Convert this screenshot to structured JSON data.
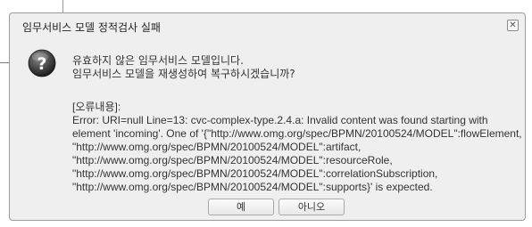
{
  "dialog": {
    "title": "임무서비스 모델 정적검사 실패",
    "close_symbol": "✕",
    "icon": "question-icon",
    "message_lines": [
      "유효하지 않은 임무서비스 모델입니다.",
      "임무서비스 모델을 재생성하여 복구하시겠습니까?"
    ],
    "detail_header": "[오류내용]:",
    "detail_lines": [
      "Error: URI=null Line=13: cvc-complex-type.2.4.a: Invalid content was found starting with",
      "element 'incoming'. One of '{\"http://www.omg.org/spec/BPMN/20100524/MODEL\":flowElement,",
      "\"http://www.omg.org/spec/BPMN/20100524/MODEL\":artifact,",
      "\"http://www.omg.org/spec/BPMN/20100524/MODEL\":resourceRole,",
      "\"http://www.omg.org/spec/BPMN/20100524/MODEL\":correlationSubscription,",
      "\"http://www.omg.org/spec/BPMN/20100524/MODEL\":supports}' is expected."
    ],
    "buttons": {
      "yes": "예",
      "no": "아니오"
    }
  },
  "colors": {
    "dialog_bg": "#efefef",
    "icon_gradient_top": "#6f6f6f",
    "icon_gradient_bottom": "#1c1c1c"
  }
}
